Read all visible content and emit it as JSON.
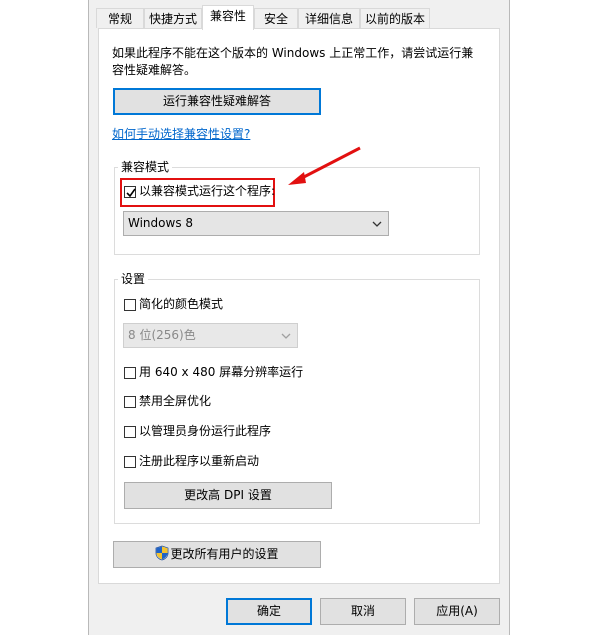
{
  "tabs": [
    {
      "label": "常规"
    },
    {
      "label": "快捷方式"
    },
    {
      "label": "兼容性"
    },
    {
      "label": "安全"
    },
    {
      "label": "详细信息"
    },
    {
      "label": "以前的版本"
    }
  ],
  "compat": {
    "intro_line1": "如果此程序不能在这个版本的 Windows 上正常工作，请尝试运行兼",
    "intro_line2": "容性疑难解答。",
    "troubleshoot_button": "运行兼容性疑难解答",
    "manual_link": "如何手动选择兼容性设置?",
    "mode_group_title": "兼容模式",
    "mode_checkbox_label": "以兼容模式运行这个程序:",
    "mode_checked": true,
    "os_selected": "Windows 8"
  },
  "settings": {
    "group_title": "设置",
    "reduced_color_label": "简化的颜色模式",
    "color_depth_selected": "8 位(256)色",
    "res_640_label": "用 640 x 480 屏幕分辨率运行",
    "disable_fullscreen_label": "禁用全屏优化",
    "run_as_admin_label": "以管理员身份运行此程序",
    "register_restart_label": "注册此程序以重新启动",
    "dpi_button": "更改高 DPI 设置"
  },
  "all_users_button": "更改所有用户的设置",
  "footer": {
    "ok": "确定",
    "cancel": "取消",
    "apply": "应用(A)"
  },
  "colors": {
    "accent": "#0078d7",
    "annotation_red": "#e21010",
    "link": "#0066cc"
  }
}
